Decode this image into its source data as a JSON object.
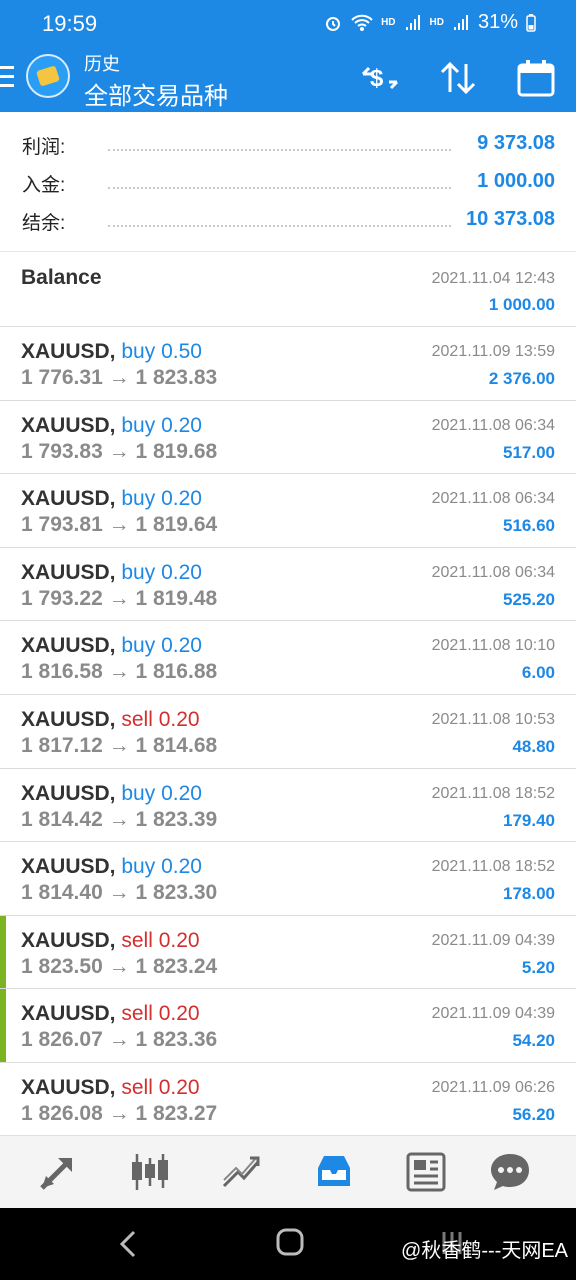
{
  "status": {
    "time": "19:59",
    "hd1": "HD",
    "hd2": "HD",
    "battery": "31%"
  },
  "appbar": {
    "subtitle": "历史",
    "title": "全部交易品种"
  },
  "summary": [
    {
      "label": "利润:",
      "value": "9 373.08"
    },
    {
      "label": "入金:",
      "value": "1 000.00"
    },
    {
      "label": "结余:",
      "value": "10 373.08"
    }
  ],
  "balance": {
    "label": "Balance",
    "date": "2021.11.04 12:43",
    "amount": "1 000.00"
  },
  "deals": [
    {
      "symbol": "XAUUSD,",
      "type": "buy",
      "volume": "0.50",
      "open": "1 776.31",
      "close": "1 823.83",
      "date": "2021.11.09 13:59",
      "profit": "2 376.00"
    },
    {
      "symbol": "XAUUSD,",
      "type": "buy",
      "volume": "0.20",
      "open": "1 793.83",
      "close": "1 819.68",
      "date": "2021.11.08 06:34",
      "profit": "517.00"
    },
    {
      "symbol": "XAUUSD,",
      "type": "buy",
      "volume": "0.20",
      "open": "1 793.81",
      "close": "1 819.64",
      "date": "2021.11.08 06:34",
      "profit": "516.60"
    },
    {
      "symbol": "XAUUSD,",
      "type": "buy",
      "volume": "0.20",
      "open": "1 793.22",
      "close": "1 819.48",
      "date": "2021.11.08 06:34",
      "profit": "525.20"
    },
    {
      "symbol": "XAUUSD,",
      "type": "buy",
      "volume": "0.20",
      "open": "1 816.58",
      "close": "1 816.88",
      "date": "2021.11.08 10:10",
      "profit": "6.00"
    },
    {
      "symbol": "XAUUSD,",
      "type": "sell",
      "volume": "0.20",
      "open": "1 817.12",
      "close": "1 814.68",
      "date": "2021.11.08 10:53",
      "profit": "48.80"
    },
    {
      "symbol": "XAUUSD,",
      "type": "buy",
      "volume": "0.20",
      "open": "1 814.42",
      "close": "1 823.39",
      "date": "2021.11.08 18:52",
      "profit": "179.40"
    },
    {
      "symbol": "XAUUSD,",
      "type": "buy",
      "volume": "0.20",
      "open": "1 814.40",
      "close": "1 823.30",
      "date": "2021.11.08 18:52",
      "profit": "178.00"
    },
    {
      "symbol": "XAUUSD,",
      "type": "sell",
      "volume": "0.20",
      "open": "1 823.50",
      "close": "1 823.24",
      "date": "2021.11.09 04:39",
      "profit": "5.20",
      "highlight": true
    },
    {
      "symbol": "XAUUSD,",
      "type": "sell",
      "volume": "0.20",
      "open": "1 826.07",
      "close": "1 823.36",
      "date": "2021.11.09 04:39",
      "profit": "54.20",
      "highlight": true
    },
    {
      "symbol": "XAUUSD,",
      "type": "sell",
      "volume": "0.20",
      "open": "1 826.08",
      "close": "1 823.27",
      "date": "2021.11.09 06:26",
      "profit": "56.20"
    }
  ],
  "arrow": "→",
  "watermark": "@秋香鹤---天网EA",
  "colors": {
    "primary": "#1e88e5",
    "sell": "#d32f2f",
    "accent": "#7bb321"
  },
  "icons": [
    "menu-icon",
    "app-logo",
    "currency-exchange-icon",
    "sort-icon",
    "calendar-icon",
    "trade-arrow-icon",
    "quotes-candles-icon",
    "chart-icon",
    "history-icon",
    "news-icon",
    "chat-icon",
    "back-icon",
    "home-icon",
    "recents-icon"
  ]
}
